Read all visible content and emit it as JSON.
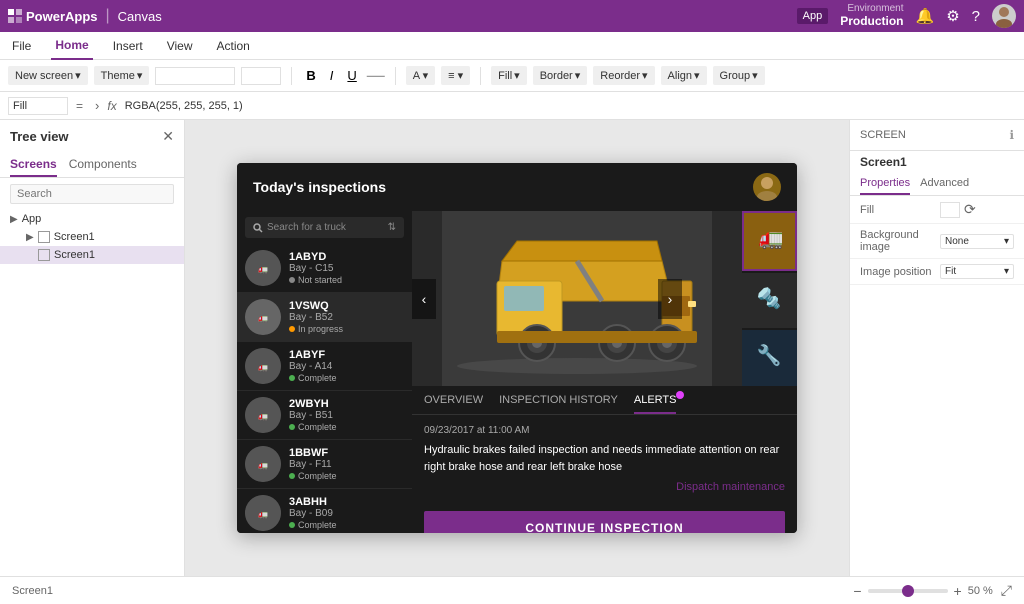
{
  "topbar": {
    "app_name": "PowerApps",
    "canvas_label": "Canvas",
    "environment_label": "Environment",
    "environment_name": "Production",
    "app_btn": "App"
  },
  "menubar": {
    "items": [
      {
        "label": "File",
        "active": false
      },
      {
        "label": "Home",
        "active": true
      },
      {
        "label": "Insert",
        "active": false
      },
      {
        "label": "View",
        "active": false
      },
      {
        "label": "Action",
        "active": false
      }
    ]
  },
  "toolbar": {
    "new_screen": "New screen",
    "theme": "Theme",
    "bold": "B",
    "italic": "I",
    "underline": "U",
    "fill": "Fill",
    "border": "Border",
    "reorder": "Reorder",
    "align": "Align",
    "group": "Group"
  },
  "formula_bar": {
    "name": "Fill",
    "eq": "=",
    "fx": "fx",
    "value": "RGBA(255, 255, 255, 1)"
  },
  "left_panel": {
    "title": "Tree view",
    "tabs": [
      "Screens",
      "Components"
    ],
    "active_tab": "Screens",
    "search_placeholder": "Search",
    "app_label": "App",
    "screens": [
      {
        "label": "Screen1",
        "level": 1
      },
      {
        "label": "Screen1",
        "level": 2
      }
    ]
  },
  "app": {
    "title": "Today's inspections",
    "search_placeholder": "Search for a truck",
    "trucks": [
      {
        "id": "1ABYD",
        "bay": "Bay - C15",
        "status": "Not started",
        "status_type": "not-started"
      },
      {
        "id": "1VSWQ",
        "bay": "Bay - B52",
        "status": "In progress",
        "status_type": "in-progress"
      },
      {
        "id": "1ABYF",
        "bay": "Bay - A14",
        "status": "Complete",
        "status_type": "complete"
      },
      {
        "id": "2WBYH",
        "bay": "Bay - B51",
        "status": "Complete",
        "status_type": "complete"
      },
      {
        "id": "1BBWF",
        "bay": "Bay - F11",
        "status": "Complete",
        "status_type": "complete"
      },
      {
        "id": "3ABHH",
        "bay": "Bay - B09",
        "status": "Complete",
        "status_type": "complete"
      }
    ],
    "detail_tabs": [
      {
        "label": "OVERVIEW",
        "active": false,
        "badge": false
      },
      {
        "label": "INSPECTION HISTORY",
        "active": false,
        "badge": false
      },
      {
        "label": "ALERTS",
        "active": true,
        "badge": true
      }
    ],
    "alert": {
      "date": "09/23/2017 at 11:00 AM",
      "text": "Hydraulic brakes failed inspection and needs immediate attention on rear right brake hose and rear left brake hose",
      "dispatch_link": "Dispatch maintenance"
    },
    "continue_btn": "CONTINUE INSPECTION"
  },
  "right_panel": {
    "screen_label": "SCREEN",
    "screen_name": "Screen1",
    "tabs": [
      "Properties",
      "Advanced"
    ],
    "active_tab": "Properties",
    "props": [
      {
        "label": "Fill",
        "type": "color"
      },
      {
        "label": "Background image",
        "value": "None"
      },
      {
        "label": "Image position",
        "value": "Fit"
      }
    ]
  },
  "bottom_bar": {
    "screen_label": "Screen1",
    "zoom_minus": "−",
    "zoom_plus": "+",
    "zoom_value": "50 %"
  }
}
